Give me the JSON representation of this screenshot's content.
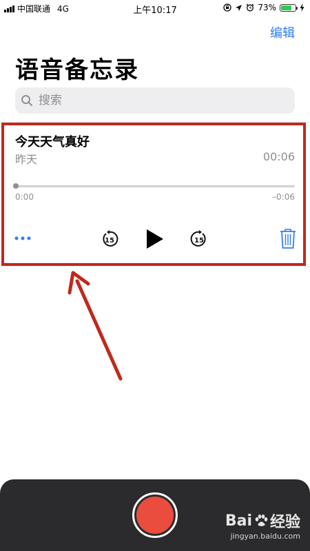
{
  "status_bar": {
    "carrier": "中国联通",
    "network": "4G",
    "time": "上午10:17",
    "battery_percent": "73%",
    "battery_level": 0.73
  },
  "nav": {
    "edit_label": "编辑",
    "title": "语音备忘录"
  },
  "search": {
    "placeholder": "搜索"
  },
  "memo": {
    "title": "今天天气真好",
    "date": "昨天",
    "duration": "00:06",
    "elapsed": "0:00",
    "remaining": "–0:06",
    "progress": 0.0,
    "skip_back_seconds": "15",
    "skip_forward_seconds": "15"
  },
  "colors": {
    "accent": "#2f7cf6",
    "record": "#ea4c3e",
    "annotation": "#c0281e",
    "panel": "#2b2b2d"
  },
  "watermark": {
    "brand_a": "Bai",
    "brand_b": "经验",
    "domain": "jingyan.baidu.com"
  }
}
